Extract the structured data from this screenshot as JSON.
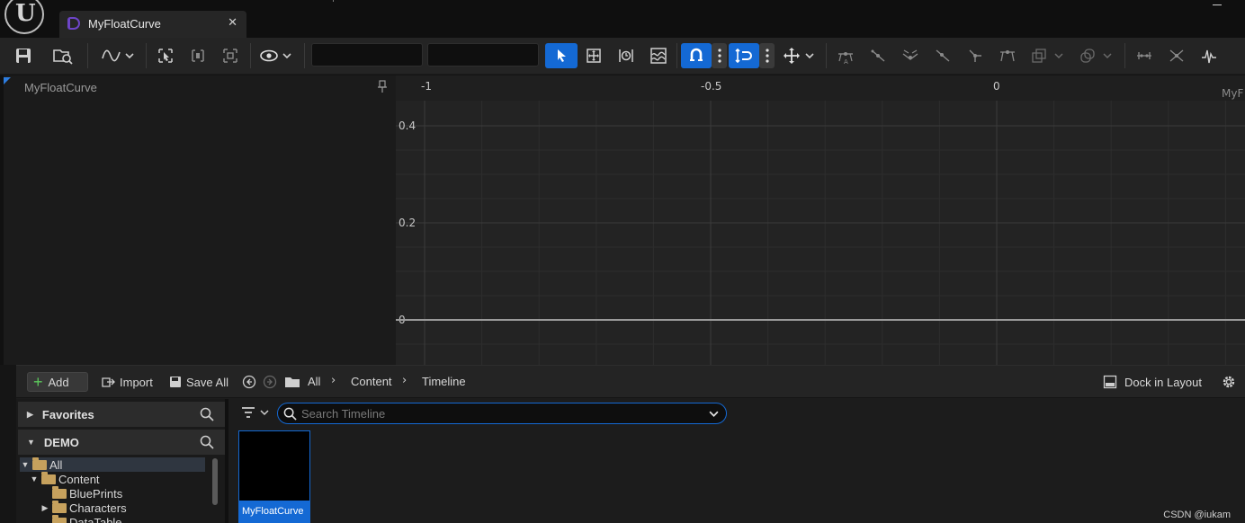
{
  "window": {
    "tab_title": "MyFloatCurve"
  },
  "icons": {
    "logo": "unreal-logo-icon",
    "asset_tab": "curve-asset-icon",
    "close": "close-icon",
    "minimize": "minimize-icon"
  },
  "toolbar": {
    "tools": [
      "save-icon",
      "browse-icon",
      "curve-display-icon",
      "select-frame-icon",
      "frame-horizontal-icon",
      "frame-vertical-icon",
      "view-options-icon",
      "select-tool-icon",
      "transform-tool-icon",
      "retime-tool-icon",
      "multi-scale-icon",
      "snap-time-icon",
      "snap-value-icon",
      "axis-snap-icon",
      "flatten-icon",
      "straighten-icon",
      "auto-tangent-icon",
      "user-tangent-icon",
      "break-tangent-icon",
      "linear-icon",
      "constant-icon",
      "pre-infinity-icon",
      "post-infinity-icon",
      "bake-icon",
      "reduce-icon",
      "normalize-icon"
    ],
    "time_field": {
      "value": ""
    },
    "value_field": {
      "value": ""
    },
    "accent_color": "#1469d4"
  },
  "curve_list": {
    "curve_name": "MyFloatCurve"
  },
  "graph": {
    "x_labels": [
      "-1",
      "-0.5",
      "0"
    ],
    "y_labels": [
      "0.4",
      "0.2",
      "0"
    ],
    "curve_label": "MyF"
  },
  "content_browser": {
    "add_label": "Add",
    "import_label": "Import",
    "save_all_label": "Save All",
    "breadcrumb": [
      "All",
      "Content",
      "Timeline"
    ],
    "dock_label": "Dock in Layout",
    "favorites_label": "Favorites",
    "project_label": "DEMO",
    "tree": [
      {
        "label": "All",
        "expanded": true,
        "selected": true
      },
      {
        "label": "Content",
        "expanded": true,
        "selected": false
      },
      {
        "label": "BluePrints",
        "expanded": false,
        "selected": false
      },
      {
        "label": "Characters",
        "expanded": false,
        "selected": false
      },
      {
        "label": "DataTable",
        "expanded": false,
        "selected": false
      }
    ],
    "search_placeholder": "Search Timeline",
    "asset_name": "MyFloatCurve"
  },
  "watermark": "CSDN @iukam"
}
